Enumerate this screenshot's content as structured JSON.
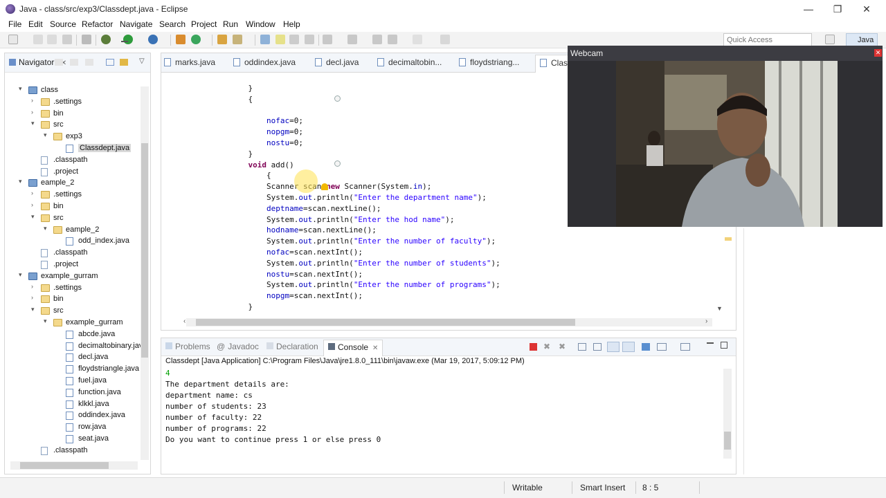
{
  "window": {
    "title": "Java - class/src/exp3/Classdept.java - Eclipse",
    "minimize": "—",
    "restore": "❐",
    "close": "✕"
  },
  "menu": [
    "File",
    "Edit",
    "Source",
    "Refactor",
    "Navigate",
    "Search",
    "Project",
    "Run",
    "Window",
    "Help"
  ],
  "toolbar": {
    "quick_access_placeholder": "Quick Access",
    "perspective": "Java"
  },
  "navigator": {
    "title": "Navigator",
    "close": "✕",
    "tree": [
      {
        "label": "class",
        "depth": 0,
        "type": "proj",
        "twisty": "▾"
      },
      {
        "label": ".settings",
        "depth": 1,
        "type": "folder",
        "twisty": "›"
      },
      {
        "label": "bin",
        "depth": 1,
        "type": "folder",
        "twisty": "›"
      },
      {
        "label": "src",
        "depth": 1,
        "type": "folder",
        "twisty": "▾"
      },
      {
        "label": "exp3",
        "depth": 2,
        "type": "folder",
        "twisty": "▾"
      },
      {
        "label": "Classdept.java",
        "depth": 3,
        "type": "javafile",
        "twisty": "",
        "selected": true
      },
      {
        "label": ".classpath",
        "depth": 1,
        "type": "file",
        "twisty": ""
      },
      {
        "label": ".project",
        "depth": 1,
        "type": "file",
        "twisty": ""
      },
      {
        "label": "eample_2",
        "depth": 0,
        "type": "proj",
        "twisty": "▾"
      },
      {
        "label": ".settings",
        "depth": 1,
        "type": "folder",
        "twisty": "›"
      },
      {
        "label": "bin",
        "depth": 1,
        "type": "folder",
        "twisty": "›"
      },
      {
        "label": "src",
        "depth": 1,
        "type": "folder",
        "twisty": "▾"
      },
      {
        "label": "eample_2",
        "depth": 2,
        "type": "folder",
        "twisty": "▾"
      },
      {
        "label": "odd_index.java",
        "depth": 3,
        "type": "javafile",
        "twisty": ""
      },
      {
        "label": ".classpath",
        "depth": 1,
        "type": "file",
        "twisty": ""
      },
      {
        "label": ".project",
        "depth": 1,
        "type": "file",
        "twisty": ""
      },
      {
        "label": "example_gurram",
        "depth": 0,
        "type": "proj",
        "twisty": "▾"
      },
      {
        "label": ".settings",
        "depth": 1,
        "type": "folder",
        "twisty": "›"
      },
      {
        "label": "bin",
        "depth": 1,
        "type": "folder",
        "twisty": "›"
      },
      {
        "label": "src",
        "depth": 1,
        "type": "folder",
        "twisty": "▾"
      },
      {
        "label": "example_gurram",
        "depth": 2,
        "type": "folder",
        "twisty": "▾"
      },
      {
        "label": "abcde.java",
        "depth": 3,
        "type": "javafile",
        "twisty": ""
      },
      {
        "label": "decimaltobinary.java",
        "depth": 3,
        "type": "javafile",
        "twisty": ""
      },
      {
        "label": "decl.java",
        "depth": 3,
        "type": "javafile",
        "twisty": ""
      },
      {
        "label": "floydstriangle.java",
        "depth": 3,
        "type": "javafile",
        "twisty": ""
      },
      {
        "label": "fuel.java",
        "depth": 3,
        "type": "javafile",
        "twisty": ""
      },
      {
        "label": "function.java",
        "depth": 3,
        "type": "javafile",
        "twisty": ""
      },
      {
        "label": "klkkl.java",
        "depth": 3,
        "type": "javafile",
        "twisty": ""
      },
      {
        "label": "oddindex.java",
        "depth": 3,
        "type": "javafile",
        "twisty": ""
      },
      {
        "label": "row.java",
        "depth": 3,
        "type": "javafile",
        "twisty": ""
      },
      {
        "label": "seat.java",
        "depth": 3,
        "type": "javafile",
        "twisty": ""
      },
      {
        "label": ".classpath",
        "depth": 1,
        "type": "file",
        "twisty": ""
      }
    ]
  },
  "editor": {
    "tabs": [
      "marks.java",
      "oddindex.java",
      "decl.java",
      "decimaltobin...",
      "floydstriang...",
      "Clas"
    ],
    "active_tab": 5,
    "code_lines": [
      [
        {
          "t": "            }"
        }
      ],
      [
        {
          "t": "            {"
        }
      ],
      [
        {
          "t": ""
        }
      ],
      [
        {
          "t": "                "
        },
        {
          "t": "nofac",
          "c": "fld"
        },
        {
          "t": "=0;"
        }
      ],
      [
        {
          "t": "                "
        },
        {
          "t": "nopgm",
          "c": "fld"
        },
        {
          "t": "=0;"
        }
      ],
      [
        {
          "t": "                "
        },
        {
          "t": "nostu",
          "c": "fld"
        },
        {
          "t": "=0;"
        }
      ],
      [
        {
          "t": "            }"
        }
      ],
      [
        {
          "t": "            "
        },
        {
          "t": "void",
          "c": "kw"
        },
        {
          "t": " add()"
        }
      ],
      [
        {
          "t": "                {"
        }
      ],
      [
        {
          "t": "                Scanner scan="
        },
        {
          "t": "new",
          "c": "kw"
        },
        {
          "t": " Scanner(System."
        },
        {
          "t": "in",
          "c": "fld"
        },
        {
          "t": ");"
        }
      ],
      [
        {
          "t": "                System."
        },
        {
          "t": "out",
          "c": "fld"
        },
        {
          "t": ".println("
        },
        {
          "t": "\"Enter the department name\"",
          "c": "str"
        },
        {
          "t": ");"
        }
      ],
      [
        {
          "t": "                "
        },
        {
          "t": "deptname",
          "c": "fld"
        },
        {
          "t": "=scan.nextLine();"
        }
      ],
      [
        {
          "t": "                System."
        },
        {
          "t": "out",
          "c": "fld"
        },
        {
          "t": ".println("
        },
        {
          "t": "\"Enter the hod name\"",
          "c": "str"
        },
        {
          "t": ");"
        }
      ],
      [
        {
          "t": "                "
        },
        {
          "t": "hodname",
          "c": "fld"
        },
        {
          "t": "=scan.nextLine();"
        }
      ],
      [
        {
          "t": "                System."
        },
        {
          "t": "out",
          "c": "fld"
        },
        {
          "t": ".println("
        },
        {
          "t": "\"Enter the number of faculty\"",
          "c": "str"
        },
        {
          "t": ");"
        }
      ],
      [
        {
          "t": "                "
        },
        {
          "t": "nofac",
          "c": "fld"
        },
        {
          "t": "=scan.nextInt();"
        }
      ],
      [
        {
          "t": "                System."
        },
        {
          "t": "out",
          "c": "fld"
        },
        {
          "t": ".println("
        },
        {
          "t": "\"Enter the number of students\"",
          "c": "str"
        },
        {
          "t": ");"
        }
      ],
      [
        {
          "t": "                "
        },
        {
          "t": "nostu",
          "c": "fld"
        },
        {
          "t": "=scan.nextInt();"
        }
      ],
      [
        {
          "t": "                System."
        },
        {
          "t": "out",
          "c": "fld"
        },
        {
          "t": ".println("
        },
        {
          "t": "\"Enter the number of programs\"",
          "c": "str"
        },
        {
          "t": ");"
        }
      ],
      [
        {
          "t": "                "
        },
        {
          "t": "nopgm",
          "c": "fld"
        },
        {
          "t": "=scan.nextInt();"
        }
      ],
      [
        {
          "t": "            }"
        }
      ]
    ]
  },
  "webcam": {
    "title": "Webcam",
    "close": "✕"
  },
  "console": {
    "tabs": [
      "Problems",
      "Javadoc",
      "Declaration",
      "Console"
    ],
    "active_tab": 3,
    "launch": "Classdept [Java Application] C:\\Program Files\\Java\\jre1.8.0_111\\bin\\javaw.exe (Mar 19, 2017, 5:09:12 PM)",
    "input_echo": "4",
    "lines": [
      "The department details are:",
      "department name: cs",
      "number of students: 23",
      "number of faculty: 22",
      "number of programs: 22",
      "Do you want to continue press 1 or else press 0"
    ]
  },
  "statusbar": {
    "writable": "Writable",
    "insert_mode": "Smart Insert",
    "position": "8 : 5"
  },
  "colors": {
    "keyword": "#7f0055",
    "field": "#0000c0",
    "string": "#2a00ff",
    "console_input": "#00a000"
  }
}
